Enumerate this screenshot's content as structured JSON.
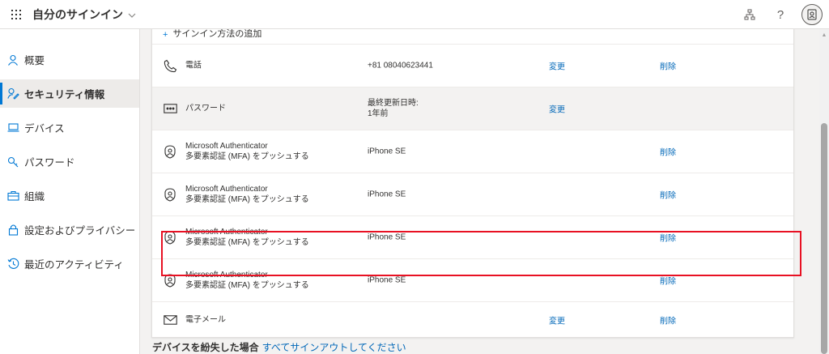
{
  "header": {
    "title": "自分のサインイン",
    "icons": [
      "waffle-icon",
      "org-chart-icon",
      "help-icon",
      "avatar-icon"
    ],
    "help_label": "?"
  },
  "sidebar": {
    "items": [
      {
        "label": "概要",
        "icon": "person-icon"
      },
      {
        "label": "セキュリティ情報",
        "icon": "security-info-icon",
        "active": true
      },
      {
        "label": "デバイス",
        "icon": "laptop-icon"
      },
      {
        "label": "パスワード",
        "icon": "key-icon"
      },
      {
        "label": "組織",
        "icon": "briefcase-icon"
      },
      {
        "label": "設定およびプライバシー",
        "icon": "lock-icon"
      },
      {
        "label": "最近のアクティビティ",
        "icon": "history-icon"
      }
    ]
  },
  "main": {
    "add_method": "サインイン方法の追加",
    "methods": [
      {
        "icon": "phone-icon",
        "name": "電話",
        "detail": "+81 08040623441",
        "change": "変更",
        "delete": "削除"
      },
      {
        "icon": "password-icon",
        "name": "パスワード",
        "detail_label": "最終更新日時:",
        "detail_value": "1年前",
        "change": "変更"
      },
      {
        "icon": "authenticator-icon",
        "name": "Microsoft Authenticator",
        "subtitle": "多要素認証 (MFA) をプッシュする",
        "detail": "iPhone SE",
        "delete": "削除"
      },
      {
        "icon": "authenticator-icon",
        "name": "Microsoft Authenticator",
        "subtitle": "多要素認証 (MFA) をプッシュする",
        "detail": "iPhone SE",
        "delete": "削除"
      },
      {
        "icon": "authenticator-icon",
        "name": "Microsoft Authenticator",
        "subtitle": "多要素認証 (MFA) をプッシュする",
        "detail": "iPhone SE",
        "delete": "削除"
      },
      {
        "icon": "authenticator-icon",
        "name": "Microsoft Authenticator",
        "subtitle": "多要素認証 (MFA) をプッシュする",
        "detail": "iPhone SE",
        "delete": "削除"
      },
      {
        "icon": "email-icon",
        "name": "電子メール",
        "change": "変更",
        "delete": "削除"
      }
    ],
    "lost_device": {
      "question": "デバイスを紛失した場合",
      "link": "すべてサインアウトしてください"
    }
  },
  "colors": {
    "accent": "#0078d4",
    "link": "#0067b8",
    "highlight_border": "#e81123"
  }
}
